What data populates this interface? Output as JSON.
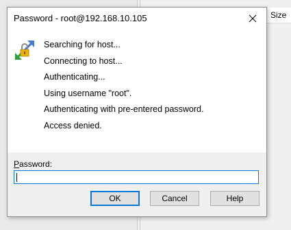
{
  "background": {
    "column_header": "Size"
  },
  "dialog": {
    "title": "Password - root@192.168.10.105",
    "log": [
      "Searching for host...",
      "Connecting to host...",
      "Authenticating...",
      "Using username \"root\".",
      "Authenticating with pre-entered password.",
      "Access denied."
    ],
    "password_label_prefix": "P",
    "password_label_rest": "assword:",
    "password_value": "",
    "buttons": {
      "ok": "OK",
      "cancel": "Cancel",
      "help": "Help"
    }
  },
  "colors": {
    "focus_accent": "#0078d7",
    "button_face": "#e1e1e1"
  },
  "icons": {
    "app": "winscp-keys-arrows-icon",
    "close": "close-icon"
  }
}
